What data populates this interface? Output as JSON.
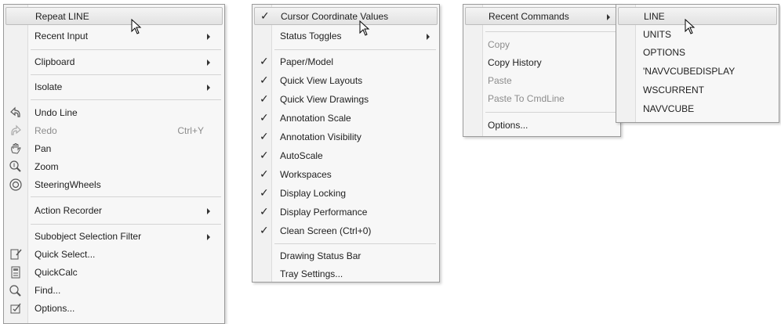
{
  "menu1": {
    "items": [
      {
        "label": "Repeat LINE"
      },
      {
        "label": "Recent Input"
      },
      {
        "label": "Clipboard"
      },
      {
        "label": "Isolate"
      },
      {
        "label": "Undo Line",
        "icon": "undo-icon"
      },
      {
        "label": "Redo",
        "shortcut": "Ctrl+Y",
        "icon": "redo-icon"
      },
      {
        "label": "Pan",
        "icon": "pan-icon"
      },
      {
        "label": "Zoom",
        "icon": "zoom-icon"
      },
      {
        "label": "SteeringWheels",
        "icon": "steeringwheels-icon"
      },
      {
        "label": "Action Recorder"
      },
      {
        "label": "Subobject Selection Filter"
      },
      {
        "label": "Quick Select...",
        "icon": "quick-select-icon"
      },
      {
        "label": "QuickCalc",
        "icon": "calculator-icon"
      },
      {
        "label": "Find...",
        "icon": "find-icon"
      },
      {
        "label": "Options...",
        "icon": "options-icon"
      }
    ]
  },
  "menu2": {
    "items": [
      {
        "label": "Cursor Coordinate Values",
        "checked": true
      },
      {
        "label": "Status Toggles"
      },
      {
        "label": "Paper/Model",
        "checked": true
      },
      {
        "label": "Quick View Layouts",
        "checked": true
      },
      {
        "label": "Quick View Drawings",
        "checked": true
      },
      {
        "label": "Annotation Scale",
        "checked": true
      },
      {
        "label": "Annotation Visibility",
        "checked": true
      },
      {
        "label": "AutoScale",
        "checked": true
      },
      {
        "label": "Workspaces",
        "checked": true
      },
      {
        "label": "Display Locking",
        "checked": true
      },
      {
        "label": "Display Performance",
        "checked": true
      },
      {
        "label": "Clean Screen (Ctrl+0)",
        "checked": true
      },
      {
        "label": "Drawing Status Bar"
      },
      {
        "label": "Tray Settings..."
      }
    ],
    "check_glyph": "✓"
  },
  "menu3": {
    "items": [
      {
        "label": "Recent Commands"
      },
      {
        "label": "Copy"
      },
      {
        "label": "Copy History"
      },
      {
        "label": "Paste"
      },
      {
        "label": "Paste To CmdLine"
      },
      {
        "label": "Options..."
      }
    ]
  },
  "submenu": {
    "items": [
      {
        "label": "LINE"
      },
      {
        "label": "UNITS"
      },
      {
        "label": "OPTIONS"
      },
      {
        "label": "'NAVVCUBEDISPLAY"
      },
      {
        "label": "WSCURRENT"
      },
      {
        "label": "NAVVCUBE"
      }
    ]
  },
  "colors": {
    "menu_bg": "#f7f7f7",
    "highlight": "#e6e6e6",
    "disabled_text": "#8c8c8c"
  }
}
